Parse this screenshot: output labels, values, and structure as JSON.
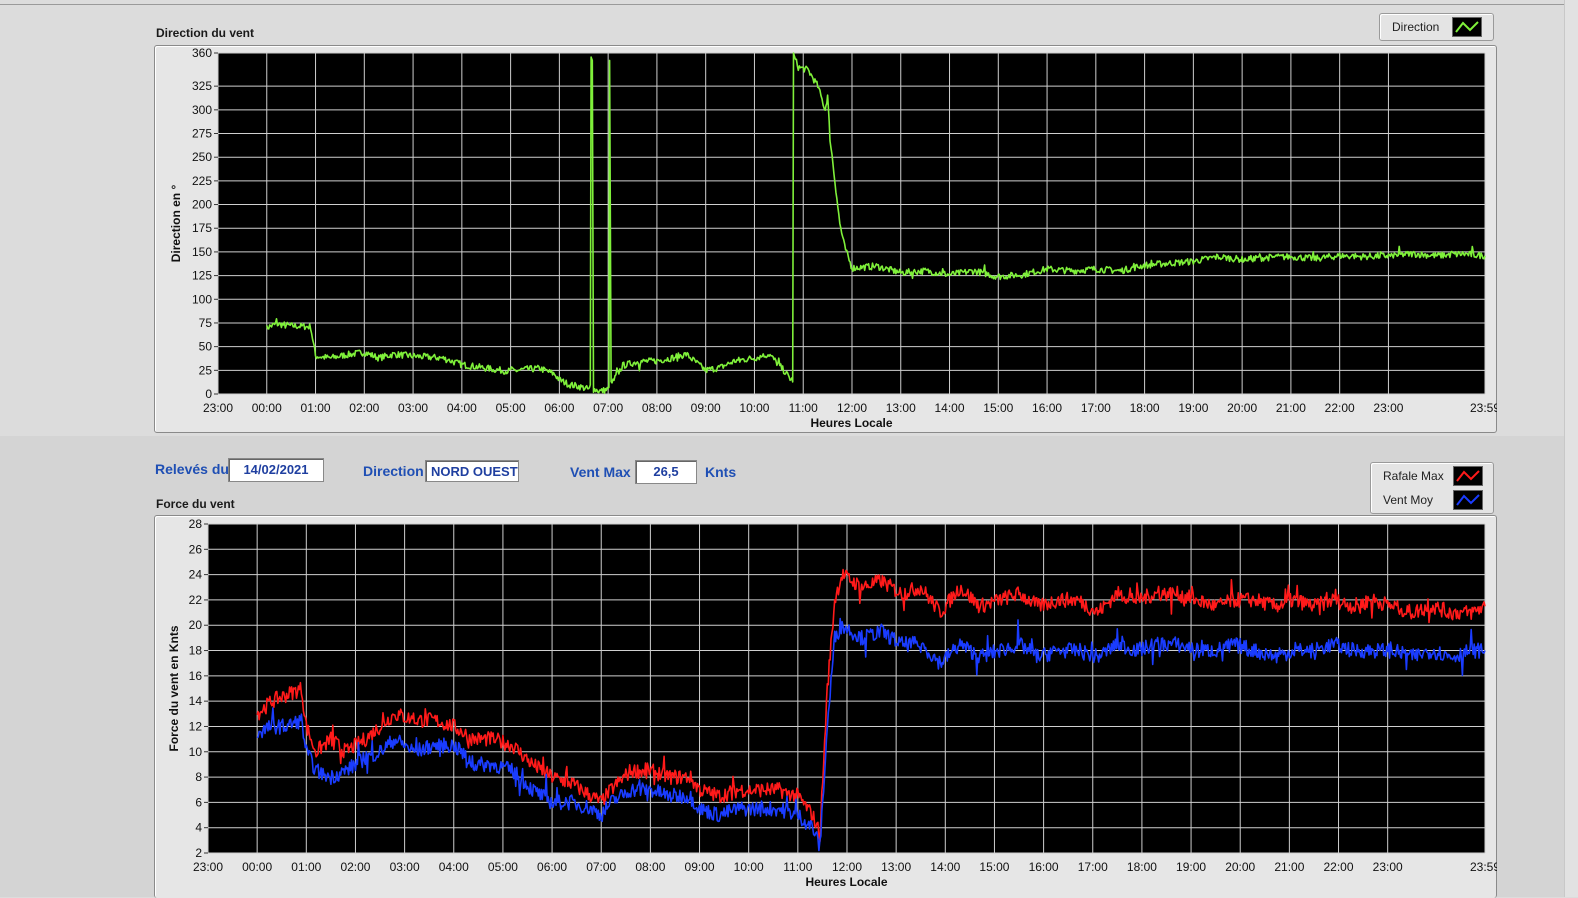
{
  "direction_panel": {
    "title": "Direction du vent",
    "legend": {
      "label": "Direction",
      "color": "#7ff03a"
    }
  },
  "info_bar": {
    "date_label": "Relevés du",
    "date_value": "14/02/2021",
    "direction_label": "Direction",
    "direction_value": "NORD OUEST",
    "vent_max_label": "Vent Max",
    "vent_max_value": "26,5",
    "unit": "Knts"
  },
  "force_panel": {
    "title": "Force du vent",
    "legend": [
      {
        "label": "Rafale Max",
        "color": "#ff1a1a"
      },
      {
        "label": "Vent Moy",
        "color": "#1a3cff"
      }
    ]
  },
  "chart_data": [
    {
      "type": "line",
      "title": "Direction du vent",
      "xlabel": "Heures Locale",
      "ylabel": "Direction en °",
      "x_ticks": [
        "23:00",
        "00:00",
        "01:00",
        "02:00",
        "03:00",
        "04:00",
        "05:00",
        "06:00",
        "07:00",
        "08:00",
        "09:00",
        "10:00",
        "11:00",
        "12:00",
        "13:00",
        "14:00",
        "15:00",
        "16:00",
        "17:00",
        "18:00",
        "19:00",
        "20:00",
        "21:00",
        "22:00",
        "23:00",
        "23:59"
      ],
      "y_ticks": [
        0,
        25,
        50,
        75,
        100,
        125,
        150,
        175,
        200,
        225,
        250,
        275,
        300,
        325,
        360
      ],
      "ylim": [
        0,
        360
      ],
      "x_range_hours": [
        -1,
        24.98
      ],
      "grid": true,
      "series": [
        {
          "name": "Direction",
          "color": "#7ff03a",
          "points": [
            [
              0.0,
              70
            ],
            [
              0.2,
              74
            ],
            [
              0.5,
              72
            ],
            [
              0.9,
              71
            ],
            [
              1.0,
              40
            ],
            [
              1.3,
              38
            ],
            [
              1.6,
              41
            ],
            [
              2.0,
              44
            ],
            [
              2.3,
              38
            ],
            [
              2.6,
              42
            ],
            [
              3.0,
              40
            ],
            [
              3.3,
              39
            ],
            [
              3.6,
              38
            ],
            [
              4.0,
              31
            ],
            [
              4.4,
              28
            ],
            [
              4.8,
              25
            ],
            [
              5.0,
              24
            ],
            [
              5.3,
              26
            ],
            [
              5.6,
              27
            ],
            [
              5.9,
              21
            ],
            [
              6.0,
              15
            ],
            [
              6.2,
              10
            ],
            [
              6.4,
              8
            ],
            [
              6.6,
              5
            ],
            [
              6.65,
              355
            ],
            [
              6.7,
              5
            ],
            [
              6.85,
              3
            ],
            [
              7.0,
              5
            ],
            [
              7.03,
              355
            ],
            [
              7.06,
              10
            ],
            [
              7.3,
              30
            ],
            [
              7.6,
              34
            ],
            [
              8.0,
              35
            ],
            [
              8.3,
              38
            ],
            [
              8.6,
              42
            ],
            [
              9.0,
              25
            ],
            [
              9.3,
              28
            ],
            [
              9.6,
              35
            ],
            [
              10.0,
              38
            ],
            [
              10.3,
              42
            ],
            [
              10.6,
              25
            ],
            [
              10.75,
              15
            ],
            [
              10.8,
              358
            ],
            [
              10.9,
              345
            ],
            [
              11.1,
              342
            ],
            [
              11.3,
              325
            ],
            [
              11.45,
              300
            ],
            [
              11.5,
              315
            ],
            [
              11.55,
              270
            ],
            [
              11.65,
              225
            ],
            [
              11.75,
              180
            ],
            [
              11.85,
              155
            ],
            [
              12.0,
              133
            ],
            [
              12.5,
              135
            ],
            [
              13.0,
              128
            ],
            [
              13.5,
              130
            ],
            [
              14.0,
              126
            ],
            [
              14.5,
              130
            ],
            [
              15.0,
              124
            ],
            [
              15.5,
              126
            ],
            [
              16.0,
              132
            ],
            [
              16.5,
              130
            ],
            [
              17.0,
              132
            ],
            [
              17.5,
              130
            ],
            [
              18.0,
              136
            ],
            [
              18.5,
              138
            ],
            [
              19.0,
              140
            ],
            [
              19.5,
              145
            ],
            [
              20.0,
              142
            ],
            [
              20.5,
              144
            ],
            [
              21.0,
              145
            ],
            [
              21.5,
              143
            ],
            [
              22.0,
              146
            ],
            [
              22.5,
              145
            ],
            [
              23.0,
              146
            ],
            [
              23.5,
              148
            ],
            [
              24.0,
              146
            ],
            [
              24.5,
              148
            ],
            [
              24.98,
              146
            ]
          ]
        }
      ]
    },
    {
      "type": "line",
      "title": "Force du vent",
      "xlabel": "Heures Locale",
      "ylabel": "Force du vent en Knts",
      "x_ticks": [
        "23:00",
        "00:00",
        "01:00",
        "02:00",
        "03:00",
        "04:00",
        "05:00",
        "06:00",
        "07:00",
        "08:00",
        "09:00",
        "10:00",
        "11:00",
        "12:00",
        "13:00",
        "14:00",
        "15:00",
        "16:00",
        "17:00",
        "18:00",
        "19:00",
        "20:00",
        "21:00",
        "22:00",
        "23:00",
        "23:59"
      ],
      "y_ticks": [
        2,
        4,
        6,
        8,
        10,
        12,
        14,
        16,
        18,
        20,
        22,
        24,
        26,
        28
      ],
      "ylim": [
        2,
        28
      ],
      "x_range_hours": [
        -1,
        24.98
      ],
      "grid": true,
      "series": [
        {
          "name": "Rafale Max",
          "color": "#ff1a1a",
          "points": [
            [
              0.0,
              13
            ],
            [
              0.3,
              14
            ],
            [
              0.6,
              14.5
            ],
            [
              0.9,
              15
            ],
            [
              1.0,
              12
            ],
            [
              1.2,
              10
            ],
            [
              1.5,
              11
            ],
            [
              1.8,
              10
            ],
            [
              2.2,
              11
            ],
            [
              2.5,
              12
            ],
            [
              2.8,
              13
            ],
            [
              3.2,
              12.5
            ],
            [
              3.6,
              12.5
            ],
            [
              4.0,
              12
            ],
            [
              4.4,
              11
            ],
            [
              4.8,
              11
            ],
            [
              5.2,
              10.5
            ],
            [
              5.6,
              9
            ],
            [
              6.0,
              8
            ],
            [
              6.4,
              7.5
            ],
            [
              6.8,
              6.5
            ],
            [
              7.0,
              6
            ],
            [
              7.2,
              7
            ],
            [
              7.6,
              8.5
            ],
            [
              8.0,
              8.5
            ],
            [
              8.4,
              8
            ],
            [
              8.8,
              8
            ],
            [
              9.0,
              7
            ],
            [
              9.4,
              6.5
            ],
            [
              9.8,
              7
            ],
            [
              10.2,
              7
            ],
            [
              10.6,
              7
            ],
            [
              11.0,
              6.5
            ],
            [
              11.3,
              5
            ],
            [
              11.45,
              3.5
            ],
            [
              11.6,
              15
            ],
            [
              11.75,
              22
            ],
            [
              11.9,
              24
            ],
            [
              12.3,
              23
            ],
            [
              12.7,
              23.5
            ],
            [
              13.1,
              22.5
            ],
            [
              13.5,
              23
            ],
            [
              13.9,
              21
            ],
            [
              14.3,
              23
            ],
            [
              14.7,
              21.5
            ],
            [
              15.1,
              22
            ],
            [
              15.5,
              22.5
            ],
            [
              15.9,
              21.5
            ],
            [
              16.3,
              22
            ],
            [
              16.7,
              22
            ],
            [
              17.1,
              21
            ],
            [
              17.5,
              22.5
            ],
            [
              17.9,
              22
            ],
            [
              18.3,
              22.5
            ],
            [
              18.7,
              22.5
            ],
            [
              19.1,
              22
            ],
            [
              19.5,
              21.5
            ],
            [
              19.9,
              22
            ],
            [
              20.3,
              22
            ],
            [
              20.7,
              21.5
            ],
            [
              21.1,
              22
            ],
            [
              21.5,
              21.5
            ],
            [
              21.9,
              22
            ],
            [
              22.3,
              21.5
            ],
            [
              22.7,
              22
            ],
            [
              23.1,
              21.5
            ],
            [
              23.5,
              21
            ],
            [
              23.9,
              21.5
            ],
            [
              24.3,
              21
            ],
            [
              24.7,
              21
            ],
            [
              24.98,
              21.5
            ]
          ]
        },
        {
          "name": "Vent Moy",
          "color": "#1a3cff",
          "points": [
            [
              0.0,
              11.5
            ],
            [
              0.3,
              12
            ],
            [
              0.6,
              12
            ],
            [
              0.9,
              12.5
            ],
            [
              1.0,
              10
            ],
            [
              1.2,
              8.5
            ],
            [
              1.5,
              8
            ],
            [
              1.8,
              8.5
            ],
            [
              2.2,
              9.5
            ],
            [
              2.5,
              10
            ],
            [
              2.8,
              11
            ],
            [
              3.2,
              10
            ],
            [
              3.6,
              10.5
            ],
            [
              4.0,
              10.5
            ],
            [
              4.4,
              9
            ],
            [
              4.8,
              9
            ],
            [
              5.2,
              8.5
            ],
            [
              5.6,
              7
            ],
            [
              6.0,
              6
            ],
            [
              6.4,
              6
            ],
            [
              6.8,
              5.5
            ],
            [
              7.0,
              5
            ],
            [
              7.2,
              6
            ],
            [
              7.6,
              7
            ],
            [
              8.0,
              7
            ],
            [
              8.4,
              6.5
            ],
            [
              8.8,
              6.5
            ],
            [
              9.0,
              5.5
            ],
            [
              9.4,
              5
            ],
            [
              9.8,
              5.5
            ],
            [
              10.2,
              5.5
            ],
            [
              10.6,
              5.5
            ],
            [
              11.0,
              5
            ],
            [
              11.3,
              4
            ],
            [
              11.45,
              2.5
            ],
            [
              11.6,
              12
            ],
            [
              11.75,
              19
            ],
            [
              11.9,
              20
            ],
            [
              12.3,
              19
            ],
            [
              12.7,
              19.5
            ],
            [
              13.1,
              18.5
            ],
            [
              13.5,
              18.5
            ],
            [
              13.9,
              17
            ],
            [
              14.3,
              18.5
            ],
            [
              14.7,
              17.5
            ],
            [
              15.1,
              18
            ],
            [
              15.5,
              18.5
            ],
            [
              15.9,
              17.5
            ],
            [
              16.3,
              18
            ],
            [
              16.7,
              18
            ],
            [
              17.1,
              17.5
            ],
            [
              17.5,
              18.5
            ],
            [
              17.9,
              18
            ],
            [
              18.3,
              18.5
            ],
            [
              18.7,
              18.5
            ],
            [
              19.1,
              18
            ],
            [
              19.5,
              18
            ],
            [
              19.9,
              18.5
            ],
            [
              20.3,
              18
            ],
            [
              20.7,
              17.5
            ],
            [
              21.1,
              18
            ],
            [
              21.5,
              18
            ],
            [
              21.9,
              18.5
            ],
            [
              22.3,
              18
            ],
            [
              22.7,
              18
            ],
            [
              23.1,
              18
            ],
            [
              23.5,
              17.5
            ],
            [
              23.9,
              18
            ],
            [
              24.3,
              17.5
            ],
            [
              24.7,
              18
            ],
            [
              24.98,
              18
            ]
          ]
        }
      ]
    }
  ]
}
